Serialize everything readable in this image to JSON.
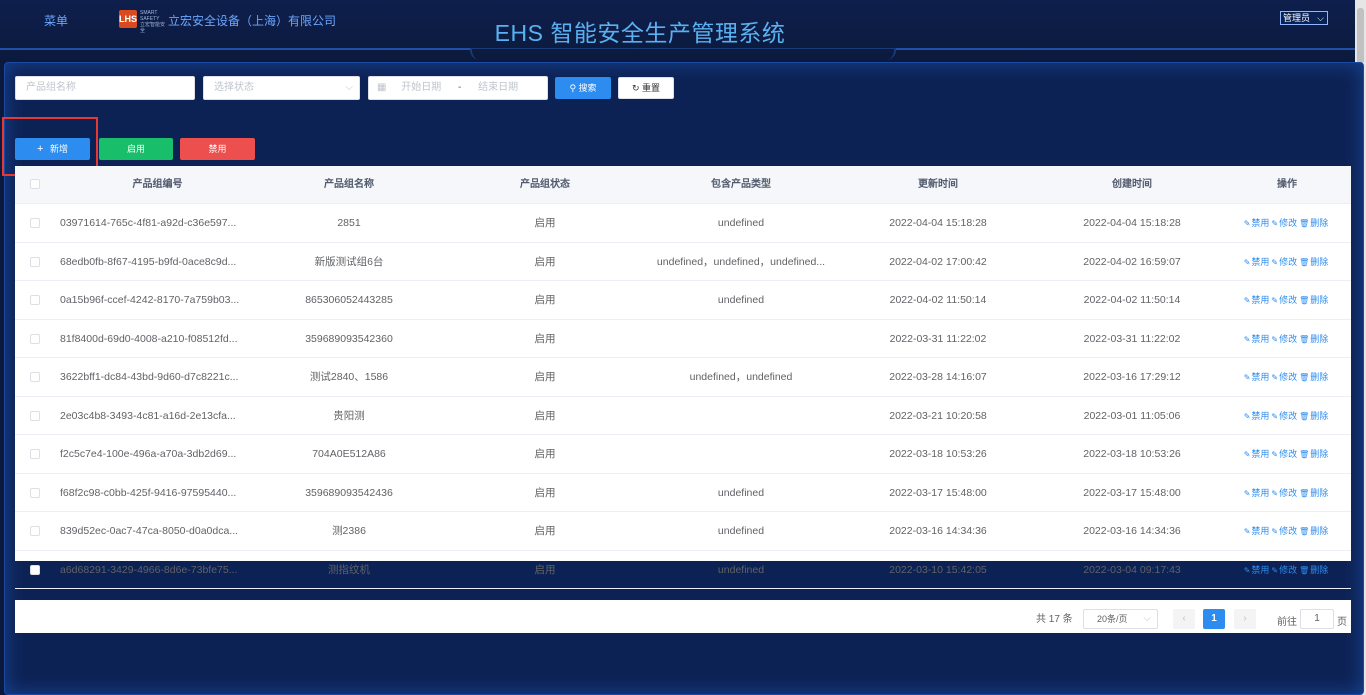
{
  "header": {
    "menu_label": "菜单",
    "logo_text": "LHS",
    "logo_sub": "SMART SAFETY 立宏智能安全",
    "company": "立宏安全设备（上海）有限公司",
    "title": "EHS 智能安全生产管理系统",
    "user": "管理员"
  },
  "filters": {
    "name_placeholder": "产品组名称",
    "status_placeholder": "选择状态",
    "start_placeholder": "开始日期",
    "date_sep": "-",
    "end_placeholder": "结束日期",
    "search_label": "搜索",
    "reset_label": "重置"
  },
  "actions": {
    "add_label": "新增",
    "enable_label": "启用",
    "disable_label": "禁用"
  },
  "table": {
    "columns": [
      "产品组编号",
      "产品组名称",
      "产品组状态",
      "包含产品类型",
      "更新时间",
      "创建时间",
      "操作"
    ],
    "op_labels": {
      "disable": "禁用",
      "edit": "修改",
      "delete": "删除"
    },
    "rows": [
      {
        "id": "03971614-765c-4f81-a92d-c36e597...",
        "name": "2851",
        "status": "启用",
        "types": "undefined",
        "updated": "2022-04-04 15:18:28",
        "created": "2022-04-04 15:18:28"
      },
      {
        "id": "68edb0fb-8f67-4195-b9fd-0ace8c9d...",
        "name": "新版测试组6台",
        "status": "启用",
        "types": "undefined，undefined，undefined...",
        "updated": "2022-04-02 17:00:42",
        "created": "2022-04-02 16:59:07"
      },
      {
        "id": "0a15b96f-ccef-4242-8170-7a759b03...",
        "name": "865306052443285",
        "status": "启用",
        "types": "undefined",
        "updated": "2022-04-02 11:50:14",
        "created": "2022-04-02 11:50:14"
      },
      {
        "id": "81f8400d-69d0-4008-a210-f08512fd...",
        "name": "359689093542360",
        "status": "启用",
        "types": "",
        "updated": "2022-03-31 11:22:02",
        "created": "2022-03-31 11:22:02"
      },
      {
        "id": "3622bff1-dc84-43bd-9d60-d7c8221c...",
        "name": "测试2840、1586",
        "status": "启用",
        "types": "undefined，undefined",
        "updated": "2022-03-28 14:16:07",
        "created": "2022-03-16 17:29:12"
      },
      {
        "id": "2e03c4b8-3493-4c81-a16d-2e13cfa...",
        "name": "贵阳测",
        "status": "启用",
        "types": "",
        "updated": "2022-03-21 10:20:58",
        "created": "2022-03-01 11:05:06"
      },
      {
        "id": "f2c5c7e4-100e-496a-a70a-3db2d69...",
        "name": "704A0E512A86",
        "status": "启用",
        "types": "",
        "updated": "2022-03-18 10:53:26",
        "created": "2022-03-18 10:53:26"
      },
      {
        "id": "f68f2c98-c0bb-425f-9416-97595440...",
        "name": "359689093542436",
        "status": "启用",
        "types": "undefined",
        "updated": "2022-03-17 15:48:00",
        "created": "2022-03-17 15:48:00"
      },
      {
        "id": "839d52ec-0ac7-47ca-8050-d0a0dca...",
        "name": "测2386",
        "status": "启用",
        "types": "undefined",
        "updated": "2022-03-16 14:34:36",
        "created": "2022-03-16 14:34:36"
      },
      {
        "id": "a6d68291-3429-4966-8d6e-73bfe75...",
        "name": "测指纹机",
        "status": "启用",
        "types": "undefined",
        "updated": "2022-03-10 15:42:05",
        "created": "2022-03-04 09:17:43"
      }
    ]
  },
  "pagination": {
    "total": "共 17 条",
    "page_size": "20条/页",
    "current_page": "1",
    "goto_label": "前往",
    "goto_value": "1",
    "page_suffix": "页"
  }
}
